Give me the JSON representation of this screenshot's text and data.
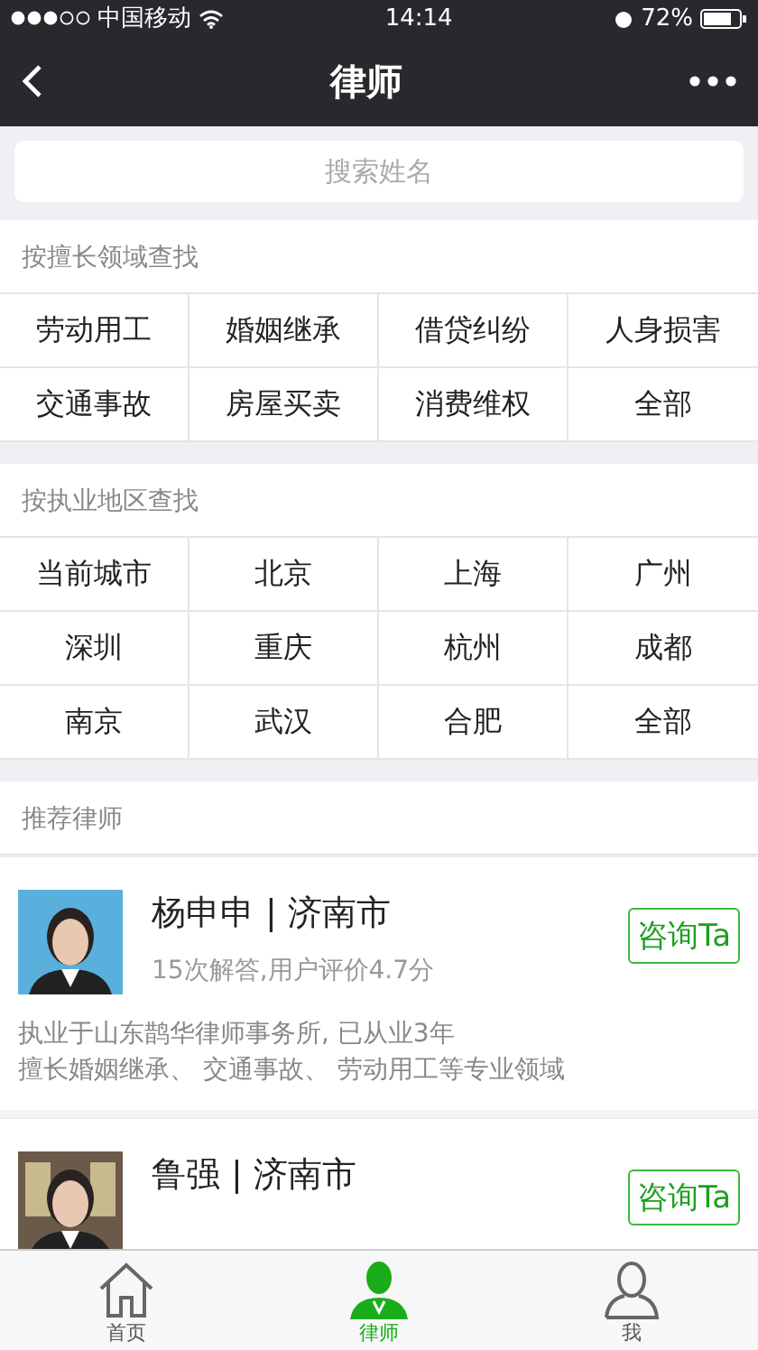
{
  "status_bar": {
    "carrier": "中国移动",
    "time": "14:14",
    "battery": "72%"
  },
  "nav": {
    "title": "律师"
  },
  "search": {
    "placeholder": "搜索姓名"
  },
  "specialty_section": {
    "title": "按擅长领域查找",
    "items": [
      "劳动用工",
      "婚姻继承",
      "借贷纠纷",
      "人身损害",
      "交通事故",
      "房屋买卖",
      "消费维权",
      "全部"
    ]
  },
  "region_section": {
    "title": "按执业地区查找",
    "items": [
      "当前城市",
      "北京",
      "上海",
      "广州",
      "深圳",
      "重庆",
      "杭州",
      "成都",
      "南京",
      "武汉",
      "合肥",
      "全部"
    ]
  },
  "recommended": {
    "title": "推荐律师",
    "lawyers": [
      {
        "title": "杨申申 | 济南市",
        "stats": "15次解答,用户评价4.7分",
        "firm": "执业于山东鹊华律师事务所, 已从业3年",
        "specialty": "擅长婚姻继承、 交通事故、 劳动用工等专业领域",
        "button": "咨询Ta"
      },
      {
        "title": "鲁强 | 济南市",
        "button": "咨询Ta"
      }
    ]
  },
  "tabs": [
    {
      "label": "首页",
      "selected": false,
      "kind": "home"
    },
    {
      "label": "律师",
      "selected": true,
      "kind": "lawyer"
    },
    {
      "label": "我",
      "selected": false,
      "kind": "me"
    }
  ]
}
